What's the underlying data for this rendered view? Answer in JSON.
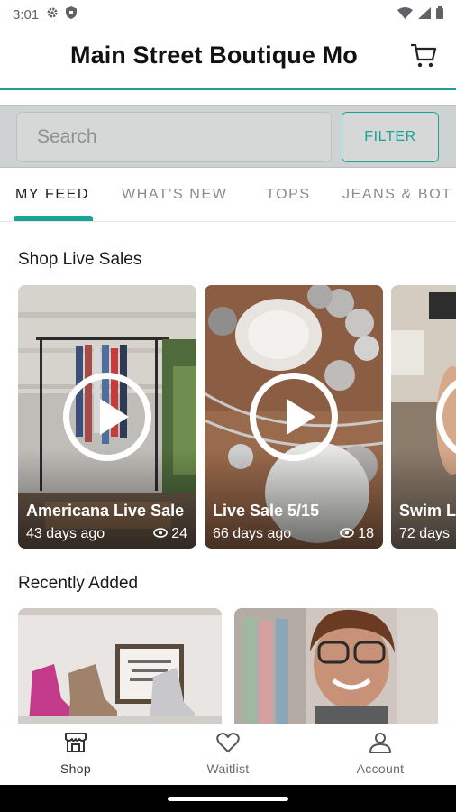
{
  "status_bar": {
    "time": "3:01"
  },
  "header": {
    "title": "Main Street Boutique Mo"
  },
  "search": {
    "placeholder": "Search",
    "filter_label": "FILTER"
  },
  "tabs": [
    {
      "label": "MY FEED",
      "active": true
    },
    {
      "label": "WHAT'S NEW",
      "active": false
    },
    {
      "label": "TOPS",
      "active": false
    },
    {
      "label": "JEANS & BOT",
      "active": false
    }
  ],
  "live_section": {
    "title": "Shop Live Sales",
    "cards": [
      {
        "title": "Americana Live Sale",
        "age": "43 days ago",
        "views": "24"
      },
      {
        "title": "Live Sale 5/15",
        "age": "66 days ago",
        "views": "18"
      },
      {
        "title": "Swim L",
        "age": "72 days",
        "views": ""
      }
    ]
  },
  "recent_section": {
    "title": "Recently Added"
  },
  "bottom_nav": [
    {
      "label": "Shop",
      "icon": "shop-icon"
    },
    {
      "label": "Waitlist",
      "icon": "heart-icon"
    },
    {
      "label": "Account",
      "icon": "person-icon"
    }
  ],
  "colors": {
    "accent": "#1aa392",
    "search_bg": "#cfd2d2"
  }
}
